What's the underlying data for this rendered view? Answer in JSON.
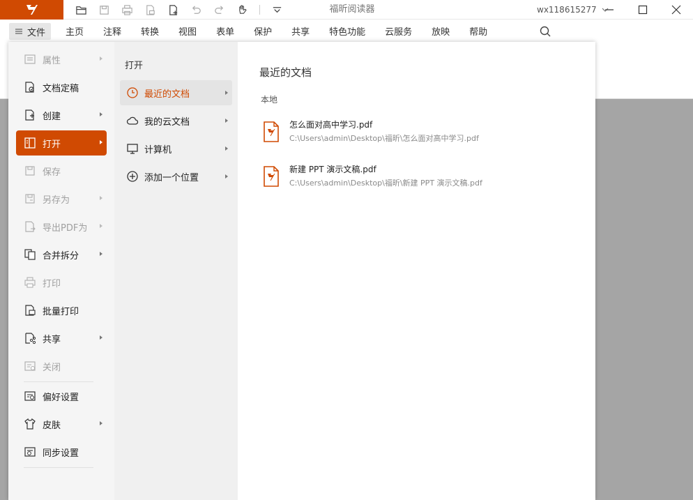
{
  "app": {
    "title": "福昕阅读器",
    "user": "wx118615277",
    "brand_color": "#d04a02"
  },
  "quick_access": [
    "open-folder-icon",
    "save-icon",
    "print-icon",
    "print-doc-icon",
    "new-doc-icon",
    "undo-icon",
    "redo-icon",
    "hand-tool-icon",
    "dropdown-icon"
  ],
  "menubar": {
    "file_label": "文件",
    "items": [
      "主页",
      "注释",
      "转换",
      "视图",
      "表单",
      "保护",
      "共享",
      "特色功能",
      "云服务",
      "放映",
      "帮助"
    ]
  },
  "file_menu": {
    "items": [
      {
        "label": "属性",
        "icon": "properties-icon",
        "disabled": true,
        "arrow": true
      },
      {
        "label": "文档定稿",
        "icon": "finalize-doc-icon",
        "disabled": false,
        "arrow": false
      },
      {
        "label": "创建",
        "icon": "create-icon",
        "disabled": false,
        "arrow": true
      },
      {
        "label": "打开",
        "icon": "open-icon",
        "disabled": false,
        "arrow": true,
        "active": true
      },
      {
        "label": "保存",
        "icon": "save-icon",
        "disabled": true,
        "arrow": false
      },
      {
        "label": "另存为",
        "icon": "save-as-icon",
        "disabled": true,
        "arrow": true
      },
      {
        "label": "导出PDF为",
        "icon": "export-pdf-icon",
        "disabled": true,
        "arrow": true
      },
      {
        "label": "合并拆分",
        "icon": "merge-split-icon",
        "disabled": false,
        "arrow": true
      },
      {
        "label": "打印",
        "icon": "print-icon",
        "disabled": true,
        "arrow": false
      },
      {
        "label": "批量打印",
        "icon": "batch-print-icon",
        "disabled": false,
        "arrow": false
      },
      {
        "label": "共享",
        "icon": "share-icon",
        "disabled": false,
        "arrow": true
      },
      {
        "label": "关闭",
        "icon": "close-doc-icon",
        "disabled": true,
        "arrow": false
      },
      {
        "label": "偏好设置",
        "icon": "preferences-icon",
        "disabled": false,
        "arrow": false
      },
      {
        "label": "皮肤",
        "icon": "skin-icon",
        "disabled": false,
        "arrow": true
      },
      {
        "label": "同步设置",
        "icon": "sync-settings-icon",
        "disabled": false,
        "arrow": false
      }
    ]
  },
  "open_submenu": {
    "heading": "打开",
    "items": [
      {
        "label": "最近的文档",
        "icon": "clock-icon",
        "active": true
      },
      {
        "label": "我的云文档",
        "icon": "cloud-icon",
        "active": false
      },
      {
        "label": "计算机",
        "icon": "monitor-icon",
        "active": false
      },
      {
        "label": "添加一个位置",
        "icon": "add-circle-icon",
        "active": false
      }
    ]
  },
  "recent": {
    "title": "最近的文档",
    "section": "本地",
    "files": [
      {
        "name": "怎么面对高中学习.pdf",
        "path": "C:\\Users\\admin\\Desktop\\福昕\\怎么面对高中学习.pdf"
      },
      {
        "name": "新建 PPT 演示文稿.pdf",
        "path": "C:\\Users\\admin\\Desktop\\福昕\\新建 PPT 演示文稿.pdf"
      }
    ]
  }
}
